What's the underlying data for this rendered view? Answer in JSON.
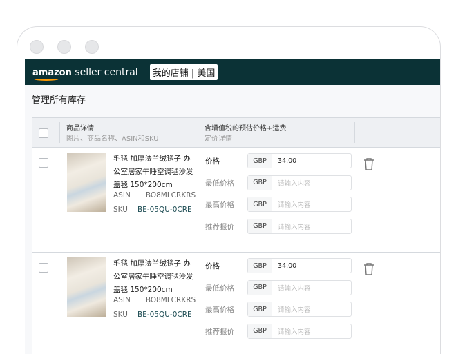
{
  "header": {
    "brand_bold": "amazon",
    "brand_rest": " seller central",
    "store": "我的店铺 | 美国"
  },
  "page_title": "管理所有库存",
  "table": {
    "columns": [
      {
        "title": "商品详情",
        "subtitle": "图片、商品名称、ASIN和SKU"
      },
      {
        "title": "含增值税的预估价格+运费",
        "subtitle": "定价详情"
      }
    ],
    "rows": [
      {
        "title": "毛毯 加厚法兰绒毯子 办公室居家午睡空调毯沙发盖毯 150*200cm",
        "asin_label": "ASIN",
        "asin": "BO8MLCRKRS",
        "sku_label": "SKU",
        "sku": "BE-05QU-0CRE",
        "prices": [
          {
            "label": "价格",
            "currency": "GBP",
            "value": "34.00",
            "placeholder": ""
          },
          {
            "label": "最低价格",
            "currency": "GBP",
            "value": "",
            "placeholder": "请输入内容"
          },
          {
            "label": "最高价格",
            "currency": "GBP",
            "value": "",
            "placeholder": "请输入内容"
          },
          {
            "label": "推荐报价",
            "currency": "GBP",
            "value": "",
            "placeholder": "请输入内容"
          }
        ]
      },
      {
        "title": "毛毯 加厚法兰绒毯子 办公室居家午睡空调毯沙发盖毯 150*200cm",
        "asin_label": "ASIN",
        "asin": "BO8MLCRKRS",
        "sku_label": "SKU",
        "sku": "BE-05QU-0CRE",
        "prices": [
          {
            "label": "价格",
            "currency": "GBP",
            "value": "34.00",
            "placeholder": ""
          },
          {
            "label": "最低价格",
            "currency": "GBP",
            "value": "",
            "placeholder": "请输入内容"
          },
          {
            "label": "最高价格",
            "currency": "GBP",
            "value": "",
            "placeholder": "请输入内容"
          },
          {
            "label": "推荐报价",
            "currency": "GBP",
            "value": "",
            "placeholder": "请输入内容"
          }
        ]
      }
    ]
  },
  "colors": {
    "header_bg": "#0b3236",
    "accent": "#ff9900"
  }
}
